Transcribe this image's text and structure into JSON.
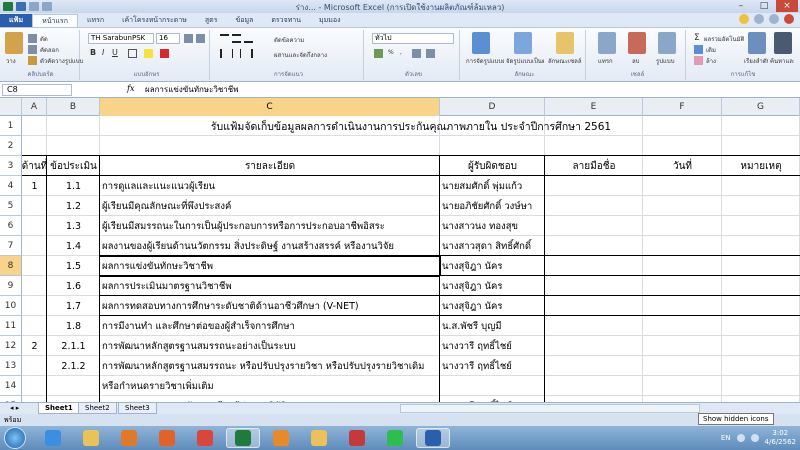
{
  "window": {
    "title": "ร่าง... - Microsoft Excel (การเปิดใช้งานผลิตภัณฑ์ล้มเหลว)"
  },
  "ribbon": {
    "tabs": [
      {
        "label": "แฟ้ม",
        "type": "file"
      },
      {
        "label": "หน้าแรก",
        "type": "active"
      },
      {
        "label": "แทรก",
        "type": ""
      },
      {
        "label": "เค้าโครงหน้ากระดาษ",
        "type": ""
      },
      {
        "label": "สูตร",
        "type": ""
      },
      {
        "label": "ข้อมูล",
        "type": ""
      },
      {
        "label": "ตรวจทาน",
        "type": ""
      },
      {
        "label": "มุมมอง",
        "type": ""
      }
    ],
    "clipboard": {
      "cut": "ตัด",
      "copy": "คัดลอก",
      "format_painter": "ตัวคัดวางรูปแบบ",
      "paste": "วาง",
      "group": "คลิปบอร์ด"
    },
    "font": {
      "name": "TH SarabunPSK",
      "size": "16",
      "group": "แบบอักษร"
    },
    "alignment": {
      "wrap": "ตัดข้อความ",
      "merge": "ผสานและจัดกึ่งกลาง",
      "group": "การจัดแนว"
    },
    "number": {
      "format": "ทั่วไป",
      "group": "ตัวเลข"
    },
    "styles": {
      "conditional": "การจัดรูปแบบตามเงื่อนไข",
      "table": "จัดรูปแบบเป็นตาราง",
      "cell": "ลักษณะเซลล์",
      "group": "ลักษณะ"
    },
    "cells": {
      "insert": "แทรก",
      "delete": "ลบ",
      "format": "รูปแบบ",
      "group": "เซลล์"
    },
    "editing": {
      "autosum": "ผลรวมอัตโนมัติ",
      "fill": "เติม",
      "clear": "ล้าง",
      "sort": "เรียงลำดับและกรอง",
      "find": "ค้นหาและเลือก",
      "group": "การแก้ไข"
    }
  },
  "formula_bar": {
    "name_box": "C8",
    "fx": "fx",
    "content": "ผลการแข่งขันทักษะวิชาชีพ"
  },
  "grid": {
    "columns": [
      "A",
      "B",
      "C",
      "D",
      "E",
      "F",
      "G"
    ],
    "selected_column": "C",
    "selected_row": "8",
    "rows": [
      {
        "n": "1",
        "title": "รับแฟ้มจัดเก็บข้อมูลผลการดำเนินงานการประกันคุณภาพภายใน ประจำปีการศึกษา 2561"
      },
      {
        "n": "2"
      },
      {
        "n": "3",
        "a": "ด้านที่",
        "b": "ข้อประเมิน",
        "c": "รายละเอียด",
        "d": "ผู้รับผิดชอบ",
        "e": "ลายมือชื่อ",
        "f": "วันที่",
        "g": "หมายเหตุ"
      },
      {
        "n": "4",
        "a": "1",
        "b": "1.1",
        "c": "การดูแลและแนะแนวผู้เรียน",
        "d": "นายสมศักดิ์ พุ่มแก้ว"
      },
      {
        "n": "5",
        "b": "1.2",
        "c": "ผู้เรียนมีคุณลักษณะที่พึงประสงค์",
        "d": "นายอภิชัยศักดิ์ วงษ์ษา"
      },
      {
        "n": "6",
        "b": "1.3",
        "c": "ผู้เรียนมีสมรรถนะในการเป็นผู้ประกอบการหรือการประกอบอาชีพอิสระ",
        "d": "นางสาวนง ทองสุข"
      },
      {
        "n": "7",
        "b": "1.4",
        "c": "ผลงานของผู้เรียนด้านนวัตกรรม สิ่งประดิษฐ์ งานสร้างสรรค์ หรืองานวิจัย",
        "d": "นางสาวสุดา สิทธิ์ศักดิ์"
      },
      {
        "n": "8",
        "b": "1.5",
        "c": "ผลการแข่งขันทักษะวิชาชีพ",
        "d": "นางสุจิฎา นัคร"
      },
      {
        "n": "9",
        "b": "1.6",
        "c": "ผลการประเมินมาตรฐานวิชาชีพ",
        "d": "นางสุจิฎา นัคร"
      },
      {
        "n": "10",
        "b": "1.7",
        "c": "ผลการทดสอบทางการศึกษาระดับชาติด้านอาชีวศึกษา (V-NET)",
        "d": "นางสุจิฎา นัคร"
      },
      {
        "n": "11",
        "b": "1.8",
        "c": "การมีงานทำ และศึกษาต่อของผู้สำเร็จการศึกษา",
        "d": "น.ส.พัชรี บุญมี"
      },
      {
        "n": "12",
        "a": "2",
        "b": "2.1.1",
        "c": "การพัฒนาหลักสูตรฐานสมรรถนะอย่างเป็นระบบ",
        "d": "นางวารี ฤทธิ์ไชย์"
      },
      {
        "n": "13",
        "b": "2.1.2",
        "c": "การพัฒนาหลักสูตรฐานสมรรถนะ หรือปรับปรุงรายวิชา หรือปรับปรุงรายวิชาเดิม",
        "d": "นางวารี ฤทธิ์ไชย์"
      },
      {
        "n": "14",
        "c": "หรือกำหนดรายวิชาเพิ่มเติม"
      },
      {
        "n": "15",
        "b": "2.2.1",
        "c": "คุณภาพของแผนการจัดการเรียนรู้สู่การปฏิบัติ",
        "d": "นางวารี ฤทธิ์ไชย์"
      }
    ]
  },
  "sheets": {
    "tabs": [
      "Sheet1",
      "Sheet2",
      "Sheet3"
    ],
    "active": "Sheet1"
  },
  "status": {
    "ready": "พร้อม"
  },
  "tooltip": "Show hidden icons",
  "taskbar": {
    "apps": [
      "internet-explorer",
      "folder",
      "media-player",
      "firefox",
      "chrome",
      "excel",
      "app-orange",
      "explorer",
      "calendar-app",
      "line",
      "word"
    ],
    "active": [
      "excel",
      "word"
    ],
    "lang": "EN",
    "time": "3:02",
    "date": "4/6/2562"
  }
}
